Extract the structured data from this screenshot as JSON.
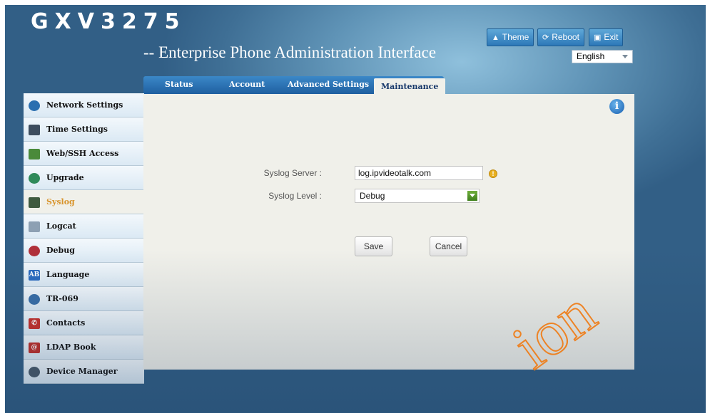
{
  "header": {
    "brand": "GXV3275",
    "subtitle": "-- Enterprise Phone Administration Interface",
    "theme_label": "Theme",
    "reboot_label": "Reboot",
    "exit_label": "Exit",
    "language_value": "English"
  },
  "tabs": [
    {
      "label": "Status"
    },
    {
      "label": "Account"
    },
    {
      "label": "Advanced Settings"
    },
    {
      "label": "Maintenance",
      "active": true
    }
  ],
  "sidebar": {
    "items": [
      {
        "label": "Network Settings",
        "icon": "network-icon"
      },
      {
        "label": "Time Settings",
        "icon": "clock-icon"
      },
      {
        "label": "Web/SSH Access",
        "icon": "remote-access-icon"
      },
      {
        "label": "Upgrade",
        "icon": "upgrade-icon"
      },
      {
        "label": "Syslog",
        "icon": "monitor-icon",
        "active": true
      },
      {
        "label": "Logcat",
        "icon": "magnifier-icon"
      },
      {
        "label": "Debug",
        "icon": "bug-icon"
      },
      {
        "label": "Language",
        "icon": "language-icon"
      },
      {
        "label": "TR-069",
        "icon": "globe-icon"
      },
      {
        "label": "Contacts",
        "icon": "phone-icon"
      },
      {
        "label": "LDAP Book",
        "icon": "address-book-icon"
      },
      {
        "label": "Device Manager",
        "icon": "gears-icon"
      }
    ]
  },
  "form": {
    "server_label": "Syslog Server :",
    "server_value": "log.ipvideotalk.com",
    "level_label": "Syslog Level :",
    "level_value": "Debug",
    "save_label": "Save",
    "cancel_label": "Cancel"
  },
  "watermark": {
    "text": "ion",
    "color": "#f07a12"
  },
  "colors": {
    "accent": "#1f5fa0",
    "active_sidebar_text": "#d8942c",
    "panel_bg": "#f0f0ea"
  }
}
